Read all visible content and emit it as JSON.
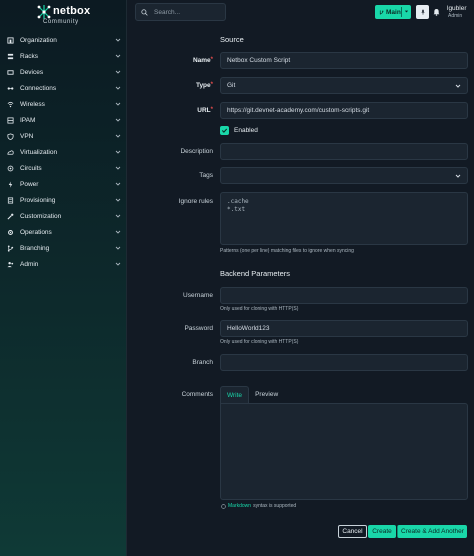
{
  "brand": {
    "name": "netbox",
    "edition": "Community",
    "accent": "#19d7a9"
  },
  "sidebar": {
    "items": [
      {
        "label": "Organization",
        "icon": "organization-icon"
      },
      {
        "label": "Racks",
        "icon": "racks-icon"
      },
      {
        "label": "Devices",
        "icon": "devices-icon"
      },
      {
        "label": "Connections",
        "icon": "connections-icon"
      },
      {
        "label": "Wireless",
        "icon": "wireless-icon"
      },
      {
        "label": "IPAM",
        "icon": "ipam-icon"
      },
      {
        "label": "VPN",
        "icon": "vpn-icon"
      },
      {
        "label": "Virtualization",
        "icon": "virtualization-icon"
      },
      {
        "label": "Circuits",
        "icon": "circuits-icon"
      },
      {
        "label": "Power",
        "icon": "power-icon"
      },
      {
        "label": "Provisioning",
        "icon": "provisioning-icon"
      },
      {
        "label": "Customization",
        "icon": "customization-icon"
      },
      {
        "label": "Operations",
        "icon": "operations-icon"
      },
      {
        "label": "Branching",
        "icon": "branching-icon"
      },
      {
        "label": "Admin",
        "icon": "admin-icon"
      }
    ]
  },
  "topbar": {
    "search_placeholder": "Search...",
    "branch_label": "Main",
    "user_name": "lgubler",
    "user_role": "Admin"
  },
  "form": {
    "section_source": "Source",
    "name_label": "Name",
    "name_value": "Netbox Custom Script",
    "type_label": "Type",
    "type_value": "Git",
    "url_label": "URL",
    "url_value": "https://git.devnet-academy.com/custom-scripts.git",
    "enabled_label": "Enabled",
    "description_label": "Description",
    "tags_label": "Tags",
    "ignore_label": "Ignore rules",
    "ignore_line1": ".cache",
    "ignore_line2": "*.txt",
    "ignore_help": "Patterns (one per line) matching files to ignore when syncing",
    "section_backend": "Backend Parameters",
    "username_label": "Username",
    "username_help": "Only used for cloning with HTTP(S)",
    "password_label": "Password",
    "password_value": "HelloWorld123",
    "password_help": "Only used for cloning with HTTP(S)",
    "branch_label": "Branch",
    "comments_label": "Comments",
    "tab_write": "Write",
    "tab_preview": "Preview",
    "markdown_link": "Markdown",
    "markdown_suffix": "syntax is supported"
  },
  "actions": {
    "cancel": "Cancel",
    "create": "Create",
    "create_add": "Create & Add Another"
  }
}
